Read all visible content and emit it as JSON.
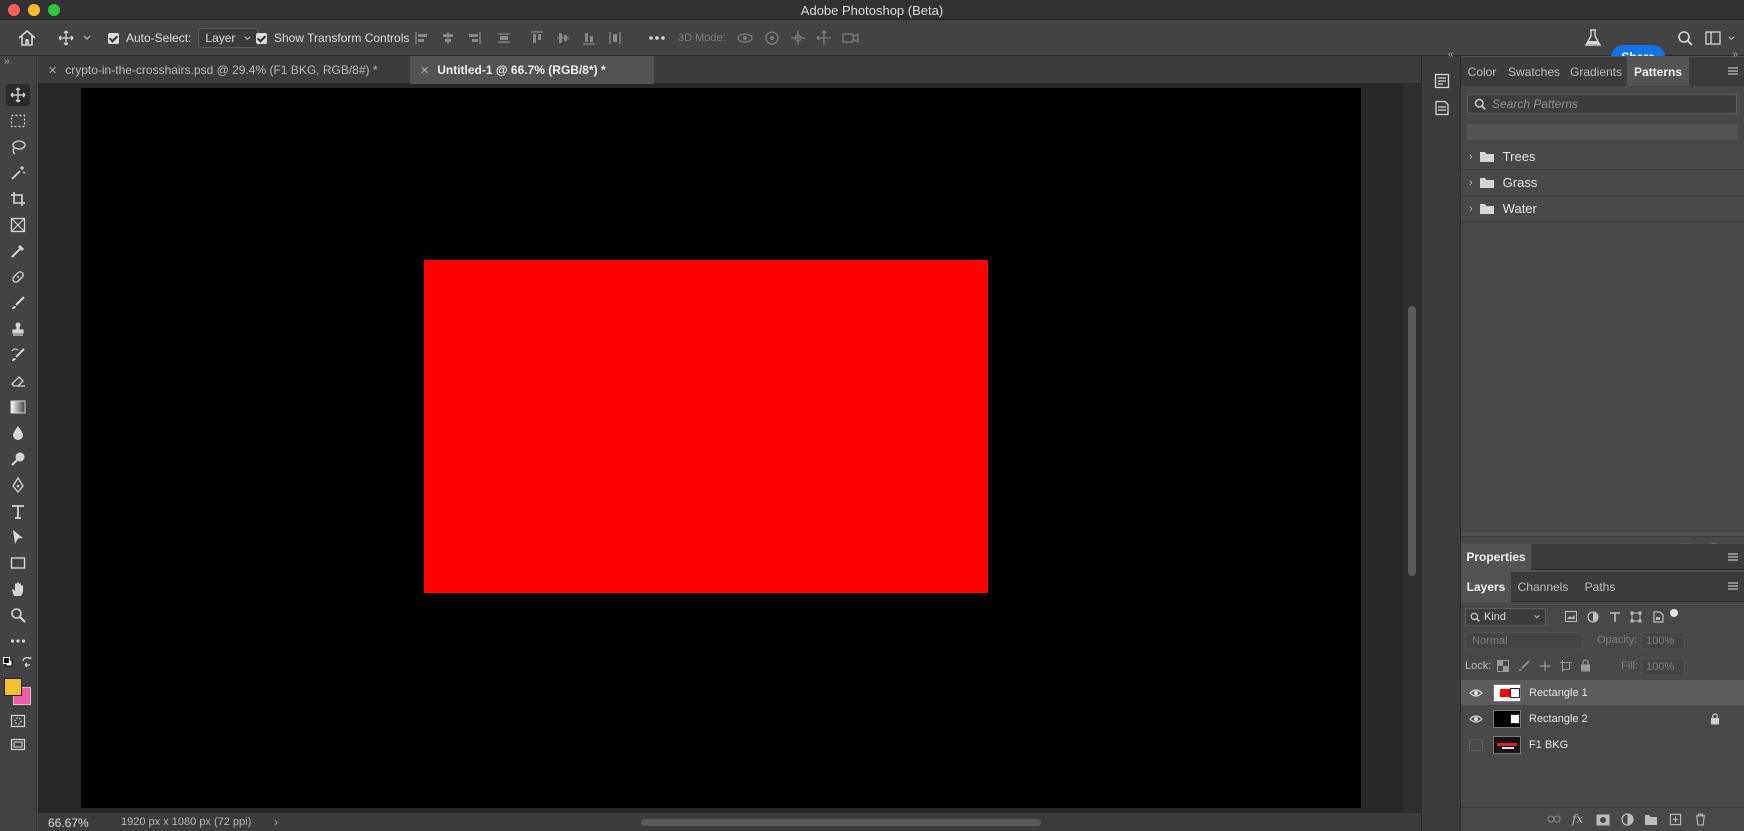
{
  "window": {
    "title": "Adobe Photoshop (Beta)"
  },
  "options_bar": {
    "auto_select_label": "Auto-Select:",
    "auto_select_value": "Layer",
    "show_transform_label": "Show Transform Controls",
    "mode_3d_label": "3D Mode:",
    "share_label": "Share"
  },
  "tabs": [
    {
      "label": "crypto-in-the-crosshairs.psd @ 29.4% (F1 BKG, RGB/8#) *"
    },
    {
      "label": "Untitled-1 @ 66.7% (RGB/8*) *"
    }
  ],
  "status": {
    "zoom": "66.67%",
    "doc_info": "1920 px x 1080 px (72 ppi)"
  },
  "colors": {
    "foreground": "#f5c12e",
    "background": "#f05aa8",
    "canvas": "#000000",
    "shape": "#ff0000",
    "accent": "#1473e6"
  },
  "patterns_panel": {
    "tabs": [
      "Color",
      "Swatches",
      "Gradients",
      "Patterns"
    ],
    "active_tab": "Patterns",
    "search_placeholder": "Search Patterns",
    "groups": [
      "Trees",
      "Grass",
      "Water"
    ]
  },
  "properties_panel": {
    "title": "Properties"
  },
  "layers_panel": {
    "tabs": [
      "Layers",
      "Channels",
      "Paths"
    ],
    "filter_kind": "Kind",
    "blend_mode": "Normal",
    "opacity_label": "Opacity:",
    "opacity_value": "100%",
    "lock_label": "Lock:",
    "fill_label": "Fill:",
    "fill_value": "100%",
    "layers": [
      {
        "name": "Rectangle 1"
      },
      {
        "name": "Rectangle 2"
      },
      {
        "name": "F1 BKG"
      }
    ]
  }
}
